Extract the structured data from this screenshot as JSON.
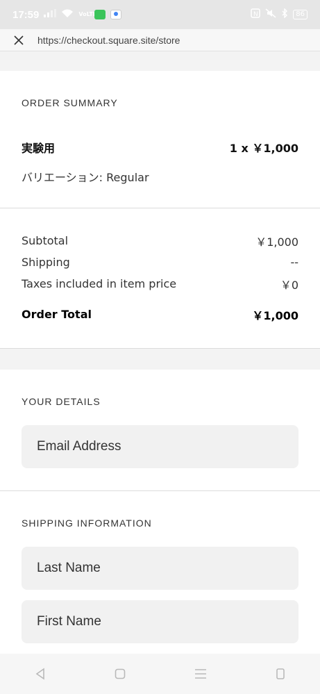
{
  "status_bar": {
    "time": "17:59",
    "network": "VoLTE",
    "battery": "86"
  },
  "url_bar": {
    "url": "https://checkout.square.site/store"
  },
  "order_summary": {
    "title": "ORDER SUMMARY",
    "item": {
      "name": "実験用",
      "qty_price": "1 x ￥1,000",
      "variation": "バリエーション: Regular"
    },
    "totals": [
      {
        "label": "Subtotal",
        "value": "￥1,000"
      },
      {
        "label": "Shipping",
        "value": "--"
      },
      {
        "label": "Taxes included in item price",
        "value": "￥0"
      }
    ],
    "order_total_label": "Order Total",
    "order_total_value": "￥1,000"
  },
  "your_details": {
    "title": "YOUR DETAILS",
    "email_placeholder": "Email Address"
  },
  "shipping_information": {
    "title": "SHIPPING INFORMATION",
    "last_name_placeholder": "Last Name",
    "first_name_placeholder": "First Name"
  },
  "colors": {
    "line_green": "#3bc45a",
    "maps_blue": "#4285f4"
  }
}
